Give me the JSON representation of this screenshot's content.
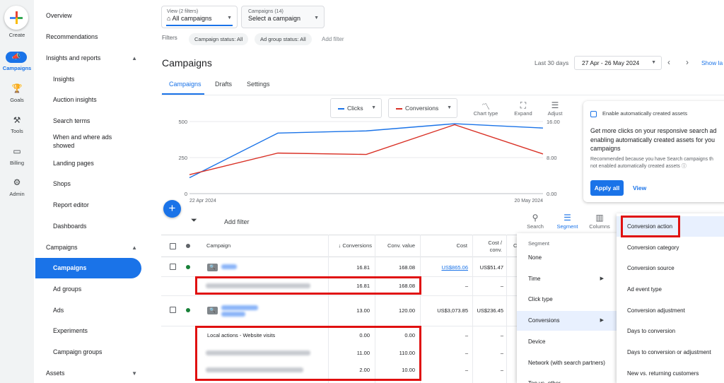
{
  "rail": {
    "create": "Create",
    "campaigns": "Campaigns",
    "goals": "Goals",
    "tools": "Tools",
    "billing": "Billing",
    "admin": "Admin"
  },
  "nav": {
    "overview": "Overview",
    "recommendations": "Recommendations",
    "insights_reports": "Insights and reports",
    "insights": "Insights",
    "auction_insights": "Auction insights",
    "search_terms": "Search terms",
    "when_where_ads": "When and where ads showed",
    "landing_pages": "Landing pages",
    "shops": "Shops",
    "report_editor": "Report editor",
    "dashboards": "Dashboards",
    "campaigns_group": "Campaigns",
    "campaigns": "Campaigns",
    "ad_groups": "Ad groups",
    "ads": "Ads",
    "experiments": "Experiments",
    "campaign_groups": "Campaign groups",
    "assets": "Assets"
  },
  "top": {
    "view_small": "View (2 filters)",
    "view_big": "All campaigns",
    "campaigns_small": "Campaigns (14)",
    "campaigns_big": "Select a campaign",
    "filters_label": "Filters",
    "chip_campaign_status": "Campaign status: All",
    "chip_adgroup_status": "Ad group status: All",
    "add_filter": "Add filter"
  },
  "header": {
    "title": "Campaigns",
    "date_label": "Last 30 days",
    "date_range": "27 Apr - 26 May 2024",
    "show_last": "Show la"
  },
  "tabs": {
    "campaigns": "Campaigns",
    "drafts": "Drafts",
    "settings": "Settings"
  },
  "chart_controls": {
    "metric1": "Clicks",
    "metric2": "Conversions",
    "chart_type": "Chart type",
    "expand": "Expand",
    "adjust": "Adjust"
  },
  "chart_data": {
    "type": "line",
    "x_start_label": "22 Apr 2024",
    "x_end_label": "20 May 2024",
    "left_ticks": [
      "500",
      "250",
      "0"
    ],
    "right_ticks": [
      "16.00",
      "8.00",
      "0.00"
    ],
    "left_range": [
      0,
      500
    ],
    "right_range": [
      0,
      16
    ],
    "grid": true,
    "series": [
      {
        "name": "Clicks",
        "color": "#1a73e8",
        "axis": "left",
        "values": [
          110,
          420,
          435,
          485,
          455
        ]
      },
      {
        "name": "Conversions",
        "color": "#d93025",
        "axis": "right",
        "values": [
          4.2,
          9.0,
          8.7,
          15.3,
          8.8
        ]
      }
    ]
  },
  "card": {
    "header": "Enable automatically created assets",
    "plus_link": "+(",
    "body_line1": "Get more clicks on your responsive search ad",
    "body_line2": "enabling automatically created assets for you",
    "body_line3": "campaigns",
    "note_line1": "Recommended because you have Search campaigns th",
    "note_line2": "not enabled automatically created assets",
    "apply": "Apply all",
    "view": "View"
  },
  "toolbar": {
    "add_filter": "Add filter",
    "search": "Search",
    "segment": "Segment",
    "columns": "Columns"
  },
  "table": {
    "headers": {
      "campaign": "Campaign",
      "conversions": "Conversions",
      "conv_value": "Conv. value",
      "cost": "Cost",
      "cost_conv_line1": "Cost /",
      "cost_conv_line2": "conv.",
      "c": "C"
    },
    "rows": [
      {
        "conversions": "16.81",
        "conv_value": "168.08",
        "cost": "US$865.06",
        "cost_conv": "US$51.47"
      },
      {
        "conversions": "16.81",
        "conv_value": "168.08",
        "cost": "–",
        "cost_conv": "–"
      },
      {
        "conversions": "13.00",
        "conv_value": "120.00",
        "cost": "US$3,073.85",
        "cost_conv": "US$236.45"
      },
      {
        "label": "Local actions - Website visits",
        "conversions": "0.00",
        "conv_value": "0.00",
        "cost": "–",
        "cost_conv": "–"
      },
      {
        "conversions": "11.00",
        "conv_value": "110.00",
        "cost": "–",
        "cost_conv": "–"
      },
      {
        "conversions": "2.00",
        "conv_value": "10.00",
        "cost": "–",
        "cost_conv": "–"
      }
    ]
  },
  "segment_menu": {
    "title": "Segment",
    "items": [
      "None",
      "Time",
      "Click type",
      "Conversions",
      "Device",
      "Network (with search partners)",
      "Top vs. other"
    ]
  },
  "sub_menu": {
    "items": [
      "Conversion action",
      "Conversion category",
      "Conversion source",
      "Ad event type",
      "Conversion adjustment",
      "Days to conversion",
      "Days to conversion or adjustment",
      "New vs. returning customers"
    ]
  },
  "colors": {
    "accent": "#1a73e8",
    "clicks": "#1a73e8",
    "conversions": "#d93025",
    "highlight": "#e01010",
    "enabled_dot": "#188038"
  }
}
